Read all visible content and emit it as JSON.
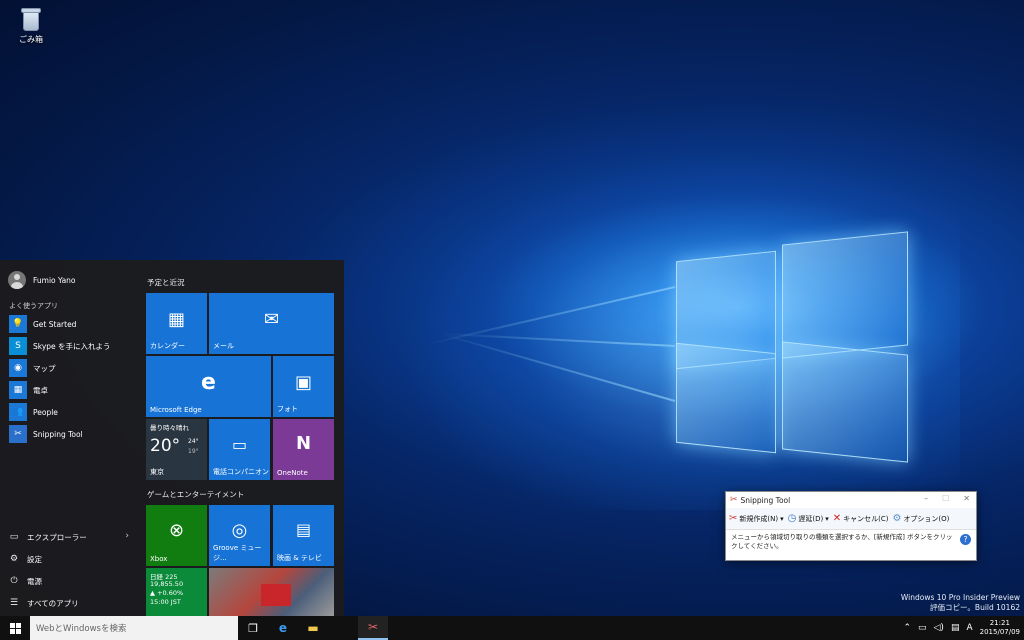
{
  "desktop": {
    "recycle_bin_label": "ごみ箱",
    "watermark_line1": "Windows 10 Pro Insider Preview",
    "watermark_line2": "評価コピー。Build 10162"
  },
  "start_menu": {
    "user_name": "Fumio Yano",
    "most_used_label": "よく使うアプリ",
    "most_used": [
      {
        "label": "Get Started",
        "icon": "lightbulb-icon"
      },
      {
        "label": "Skype を手に入れよう",
        "icon": "skype-icon"
      },
      {
        "label": "マップ",
        "icon": "map-pin-icon"
      },
      {
        "label": "電卓",
        "icon": "calculator-icon"
      },
      {
        "label": "People",
        "icon": "people-icon"
      },
      {
        "label": "Snipping Tool",
        "icon": "scissors-icon"
      }
    ],
    "system": [
      {
        "label": "エクスプローラー",
        "icon": "folder-icon"
      },
      {
        "label": "設定",
        "icon": "gear-icon"
      },
      {
        "label": "電源",
        "icon": "power-icon"
      },
      {
        "label": "すべてのアプリ",
        "icon": "list-icon"
      }
    ],
    "group1_label": "予定と近況",
    "group2_label": "ゲームとエンターテイメント",
    "tiles": {
      "calendar": "カレンダー",
      "mail": "メール",
      "edge": "Microsoft Edge",
      "photos": "フォト",
      "weather_condition": "曇り時々晴れ",
      "weather_temp": "20°",
      "weather_high": "24°",
      "weather_low": "19°",
      "weather_city": "東京",
      "phone": "電話コンパニオン",
      "onenote": "OneNote",
      "xbox": "Xbox",
      "groove": "Groove ミュージ...",
      "movies": "映画 & テレビ",
      "money_index": "日経 225",
      "money_value": "19,855.50",
      "money_change": "▲ +0.60%",
      "money_time": "15:00 JST"
    }
  },
  "taskbar": {
    "search_placeholder": "WebとWindowsを検索",
    "ime_indicator": "A",
    "time": "21:21",
    "date": "2015/07/09"
  },
  "snipping_tool": {
    "title": "Snipping Tool",
    "new_label": "新規作成(N)",
    "delay_label": "遅延(D)",
    "cancel_label": "キャンセル(C)",
    "options_label": "オプション(O)",
    "message": "メニューから領域切り取りの種類を選択するか、[新規作成] ボタンをクリックしてください。"
  }
}
